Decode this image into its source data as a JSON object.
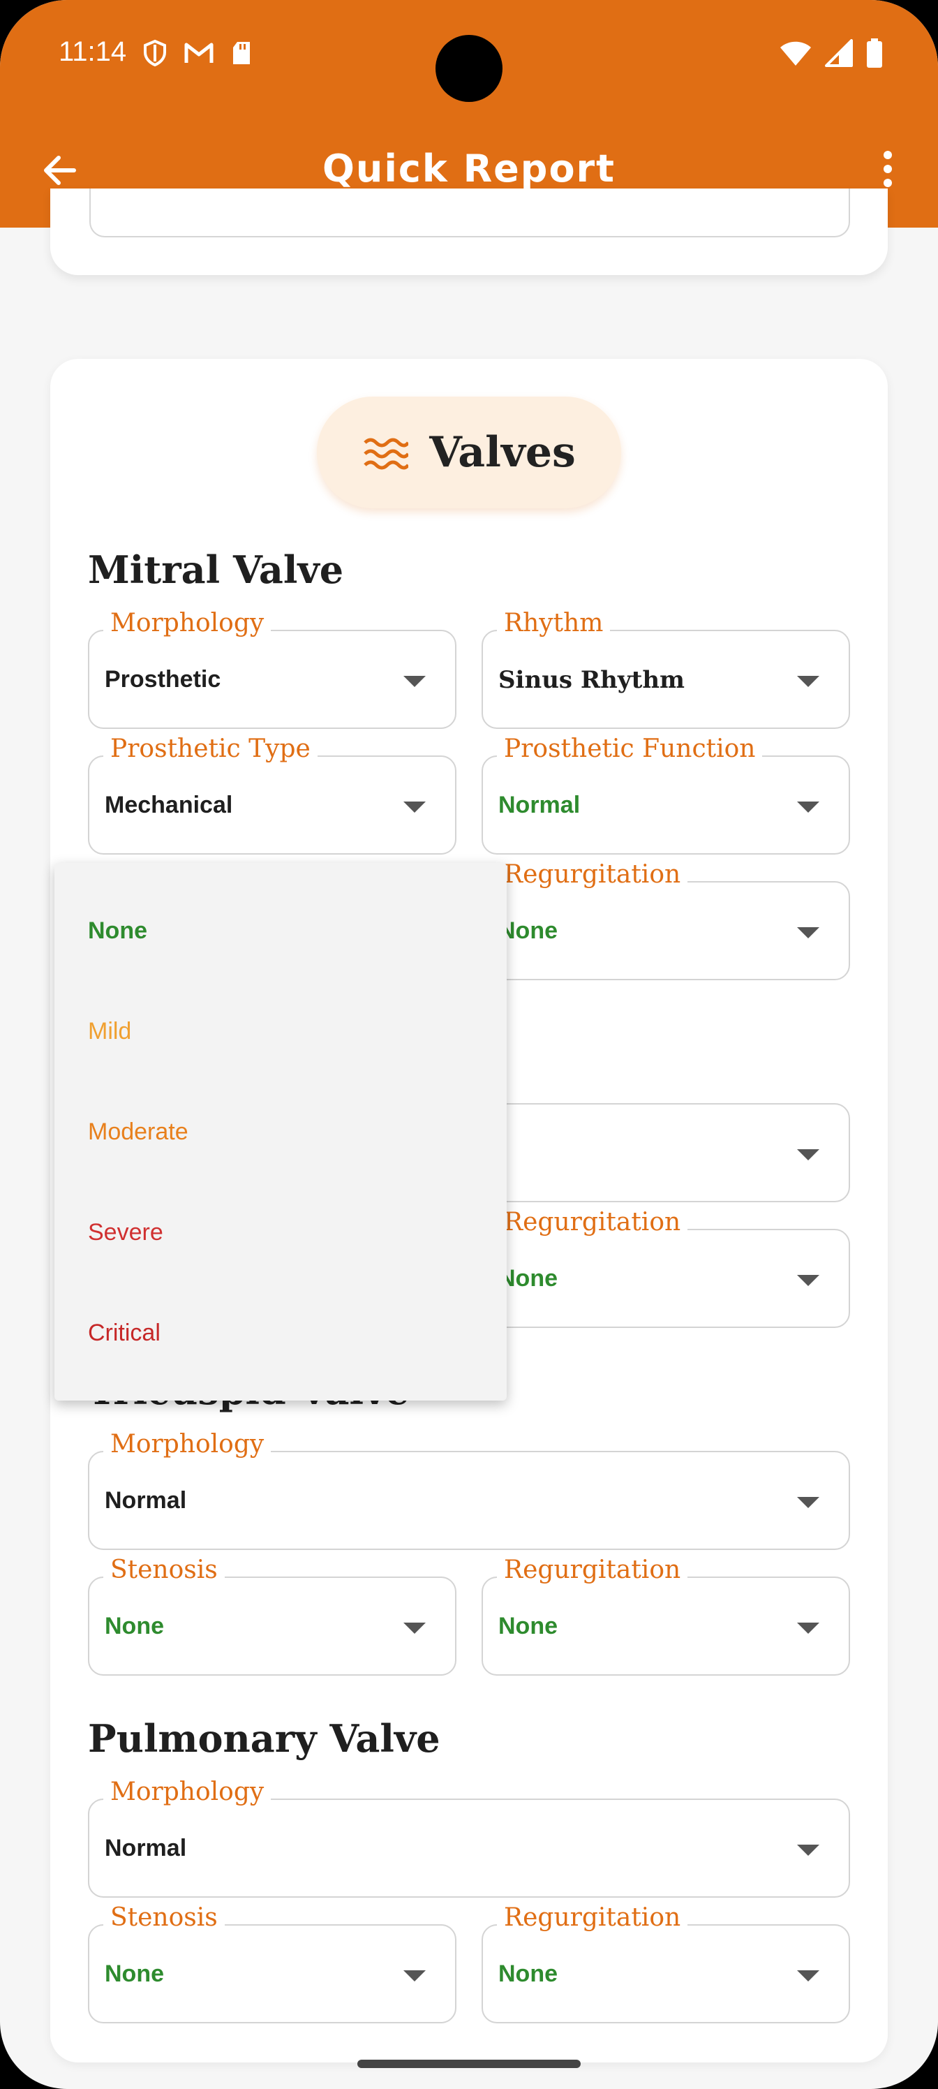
{
  "status_bar": {
    "time": "11:14"
  },
  "app_bar": {
    "title": "Quick Report"
  },
  "section_chip": {
    "label": "Valves",
    "icon": "waves-icon"
  },
  "mitral": {
    "title": "Mitral Valve",
    "morphology": {
      "label": "Morphology",
      "value": "Prosthetic"
    },
    "rhythm": {
      "label": "Rhythm",
      "value": "Sinus Rhythm"
    },
    "prosthetic_type": {
      "label": "Prosthetic Type",
      "value": "Mechanical"
    },
    "prosthetic_function": {
      "label": "Prosthetic Function",
      "value": "Normal"
    },
    "regurgitation": {
      "label": "Regurgitation",
      "value": "None"
    }
  },
  "aortic": {
    "regurgitation": {
      "label": "Regurgitation",
      "value": "None"
    }
  },
  "tricuspid": {
    "title": "Tricuspid Valve",
    "morphology": {
      "label": "Morphology",
      "value": "Normal"
    },
    "stenosis": {
      "label": "Stenosis",
      "value": "None"
    },
    "regurgitation": {
      "label": "Regurgitation",
      "value": "None"
    }
  },
  "pulmonary": {
    "title": "Pulmonary Valve",
    "morphology": {
      "label": "Morphology",
      "value": "Normal"
    },
    "stenosis": {
      "label": "Stenosis",
      "value": "None"
    },
    "regurgitation": {
      "label": "Regurgitation",
      "value": "None"
    }
  },
  "dropdown_menu": {
    "options": [
      {
        "label": "None",
        "color": "#2e8b2e"
      },
      {
        "label": "Mild",
        "color": "#f0a030"
      },
      {
        "label": "Moderate",
        "color": "#e8801c"
      },
      {
        "label": "Severe",
        "color": "#d03030"
      },
      {
        "label": "Critical",
        "color": "#c62828"
      }
    ]
  },
  "colors": {
    "accent": "#e06e14",
    "chip_background": "#fdefe0",
    "value_green": "#2e8b2e"
  }
}
